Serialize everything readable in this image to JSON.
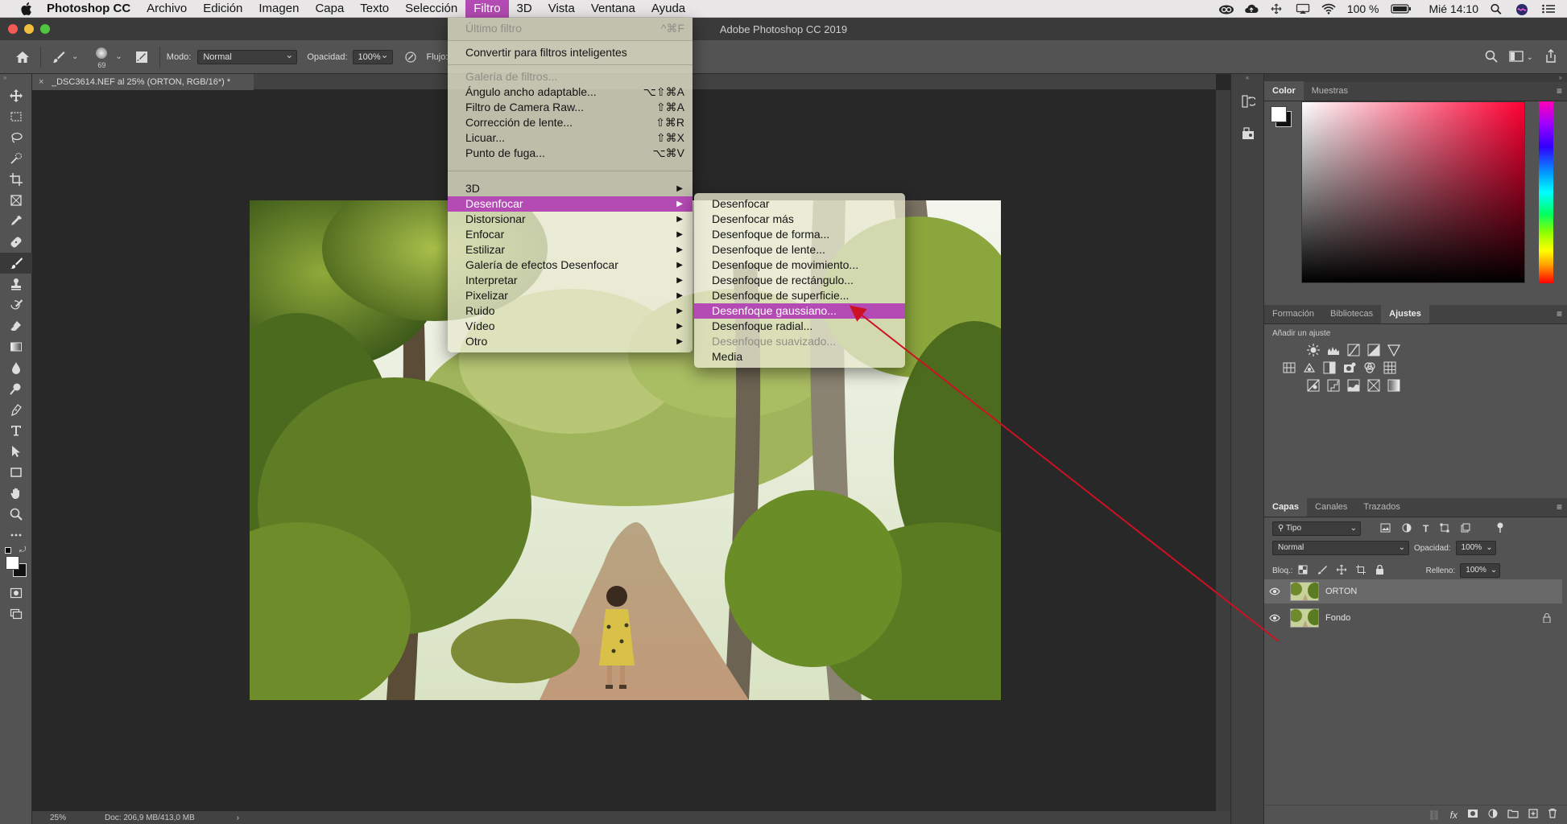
{
  "menubar": {
    "app": "Photoshop CC",
    "items": [
      "Archivo",
      "Edición",
      "Imagen",
      "Capa",
      "Texto",
      "Selección",
      "Filtro",
      "3D",
      "Vista",
      "Ventana",
      "Ayuda"
    ],
    "active": "Filtro",
    "battery": "100 %",
    "clock": "Mié 14:10"
  },
  "window": {
    "title": "Adobe Photoshop CC 2019"
  },
  "options": {
    "brush_size": "69",
    "mode_label": "Modo:",
    "mode_value": "Normal",
    "opacity_label": "Opacidad:",
    "opacity_value": "100%",
    "flow_label": "Flujo:"
  },
  "document": {
    "tab": "_DSC3614.NEF al 25% (ORTON, RGB/16*) *",
    "zoom": "25%",
    "doc_size": "Doc: 206,9 MB/413,0 MB"
  },
  "filter_menu": {
    "items": [
      {
        "label": "Último filtro",
        "shortcut": "^⌘F",
        "disabled": true
      },
      {
        "label": "Convertir para filtros inteligentes",
        "shortcut": ""
      },
      {
        "label": "Galería de filtros...",
        "shortcut": "",
        "disabled": true
      },
      {
        "label": "Ángulo ancho adaptable...",
        "shortcut": "⌥⇧⌘A"
      },
      {
        "label": "Filtro de Camera Raw...",
        "shortcut": "⇧⌘A"
      },
      {
        "label": "Corrección de lente...",
        "shortcut": "⇧⌘R"
      },
      {
        "label": "Licuar...",
        "shortcut": "⇧⌘X"
      },
      {
        "label": "Punto de fuga...",
        "shortcut": "⌥⌘V"
      },
      {
        "label": "3D",
        "submenu": true
      },
      {
        "label": "Desenfocar",
        "submenu": true,
        "highlight": true
      },
      {
        "label": "Distorsionar",
        "submenu": true
      },
      {
        "label": "Enfocar",
        "submenu": true
      },
      {
        "label": "Estilizar",
        "submenu": true
      },
      {
        "label": "Galería de efectos Desenfocar",
        "submenu": true
      },
      {
        "label": "Interpretar",
        "submenu": true
      },
      {
        "label": "Pixelizar",
        "submenu": true
      },
      {
        "label": "Ruido",
        "submenu": true
      },
      {
        "label": "Vídeo",
        "submenu": true
      },
      {
        "label": "Otro",
        "submenu": true
      }
    ]
  },
  "blur_menu": {
    "items": [
      {
        "label": "Desenfocar"
      },
      {
        "label": "Desenfocar más"
      },
      {
        "label": "Desenfoque de forma..."
      },
      {
        "label": "Desenfoque de lente..."
      },
      {
        "label": "Desenfoque de movimiento..."
      },
      {
        "label": "Desenfoque de rectángulo..."
      },
      {
        "label": "Desenfoque de superficie..."
      },
      {
        "label": "Desenfoque gaussiano...",
        "highlight": true
      },
      {
        "label": "Desenfoque radial..."
      },
      {
        "label": "Desenfoque suavizado...",
        "disabled": true
      },
      {
        "label": "Media"
      }
    ]
  },
  "panels": {
    "color_tabs": [
      "Color",
      "Muestras"
    ],
    "adjust_tabs": [
      "Formación",
      "Bibliotecas",
      "Ajustes"
    ],
    "adjust_hint": "Añadir un ajuste",
    "layer_tabs": [
      "Capas",
      "Canales",
      "Trazados"
    ],
    "filter_kind": "Tipo",
    "blend_mode": "Normal",
    "opacity_label": "Opacidad:",
    "opacity_value": "100%",
    "lock_label": "Bloq.:",
    "fill_label": "Relleno:",
    "fill_value": "100%",
    "layers": [
      {
        "name": "ORTON",
        "selected": true
      },
      {
        "name": "Fondo",
        "locked": true
      }
    ]
  },
  "colors": {
    "accent": "#b44ab4",
    "annotation": "#cc1122"
  }
}
